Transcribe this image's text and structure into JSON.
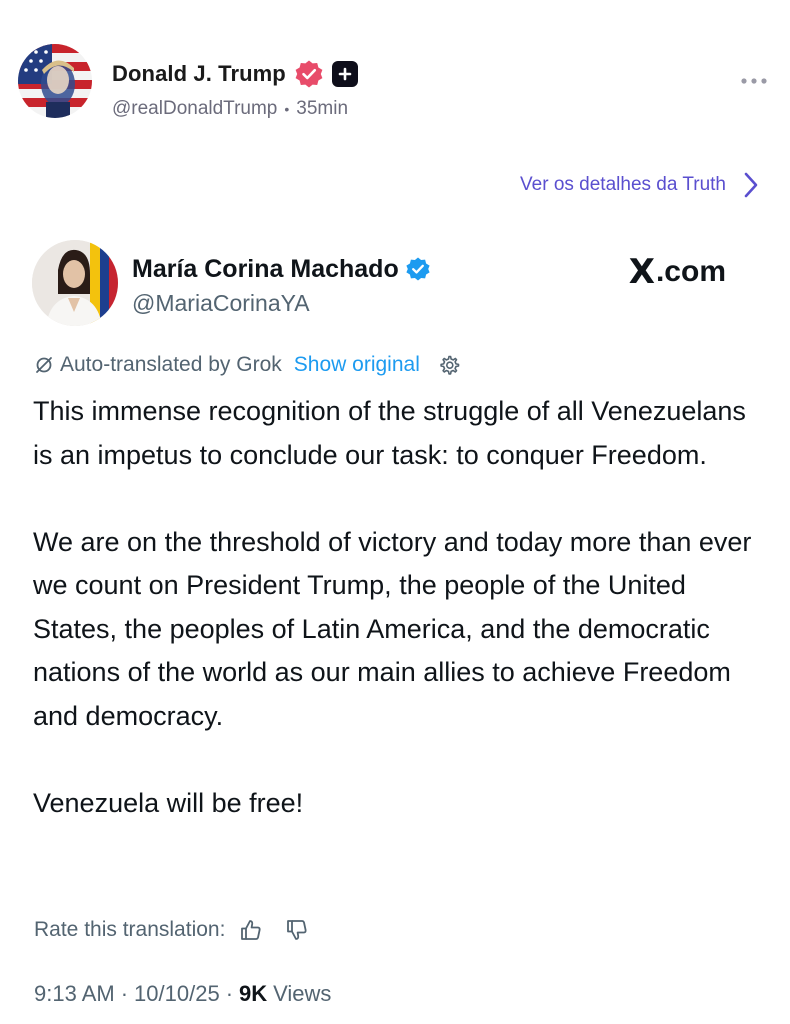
{
  "truth_post": {
    "author_name": "Donald J. Trump",
    "handle": "@realDonaldTrump",
    "separator": "•",
    "time_ago": "35min",
    "more_icon": "ellipsis-icon",
    "details_link": "Ver os detalhes da Truth",
    "verified_color": "#e84c6a",
    "accent_color": "#5a4fcf"
  },
  "x_post": {
    "author_name": "María Corina Machado",
    "handle": "@MariaCorinaYA",
    "brand": ".com",
    "brand_x": "X",
    "translation": {
      "label": "Auto-translated by Grok",
      "show_original": "Show original"
    },
    "body": [
      "This immense recognition of the struggle of all Venezuelans is an impetus to conclude our task: to conquer Freedom.",
      "We are on the threshold of victory and today more than ever we count on President Trump, the people of the United States, the peoples of Latin America, and the democratic nations of the world as our main allies to achieve Freedom and democracy.",
      "Venezuela will be free!"
    ],
    "rate_label": "Rate this translation:",
    "time": "9:13 AM",
    "date": "10/10/25",
    "dot": "·",
    "views_count": "9K",
    "views_label": "Views",
    "verified_color": "#1d9bf0",
    "link_color": "#1d9bf0"
  }
}
